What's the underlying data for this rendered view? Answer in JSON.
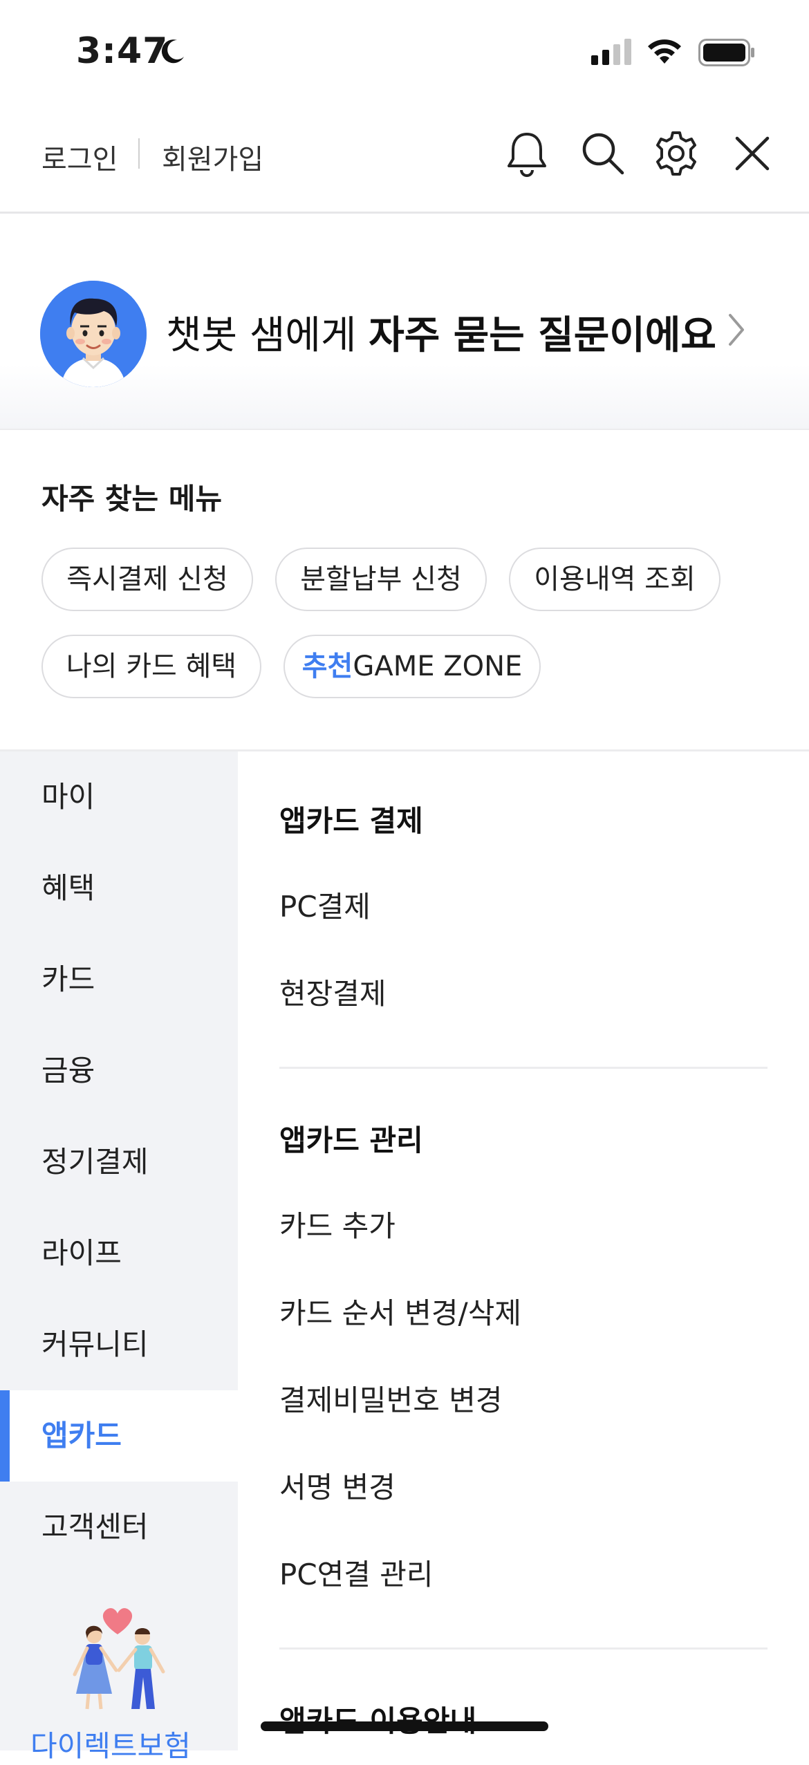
{
  "status": {
    "time": "3:47"
  },
  "header": {
    "login": "로그인",
    "signup": "회원가입"
  },
  "chatbot": {
    "prefix": "챗봇 샘에게 ",
    "bold": "자주 묻는 질문이에요"
  },
  "frequent": {
    "title": "자주 찾는 메뉴",
    "chips": [
      "즉시결제 신청",
      "분할납부 신청",
      "이용내역 조회",
      "나의 카드 혜택"
    ],
    "game_hl": "추천",
    "game_rest": "GAME ZONE"
  },
  "nav": {
    "items": [
      "마이",
      "혜택",
      "카드",
      "금융",
      "정기결제",
      "라이프",
      "커뮤니티",
      "앱카드",
      "고객센터"
    ],
    "active": "앱카드",
    "promo_text": "다이렉트보험"
  },
  "content": {
    "sections": [
      {
        "title": "앱카드 결제",
        "items": [
          "PC결제",
          "현장결제"
        ]
      },
      {
        "title": "앱카드 관리",
        "items": [
          "카드 추가",
          "카드 순서 변경/삭제",
          "결제비밀번호 변경",
          "서명 변경",
          "PC연결 관리"
        ]
      },
      {
        "title": "앱카드 이용안내",
        "items": []
      }
    ]
  },
  "colors": {
    "accent": "#3f7ef0",
    "nav_bg": "#f2f3f6",
    "divider": "#ececee"
  },
  "icons": [
    "moon-icon",
    "cellular-signal-icon",
    "wifi-icon",
    "battery-icon",
    "bell-icon",
    "search-icon",
    "gear-icon",
    "close-icon",
    "chevron-right-icon"
  ]
}
